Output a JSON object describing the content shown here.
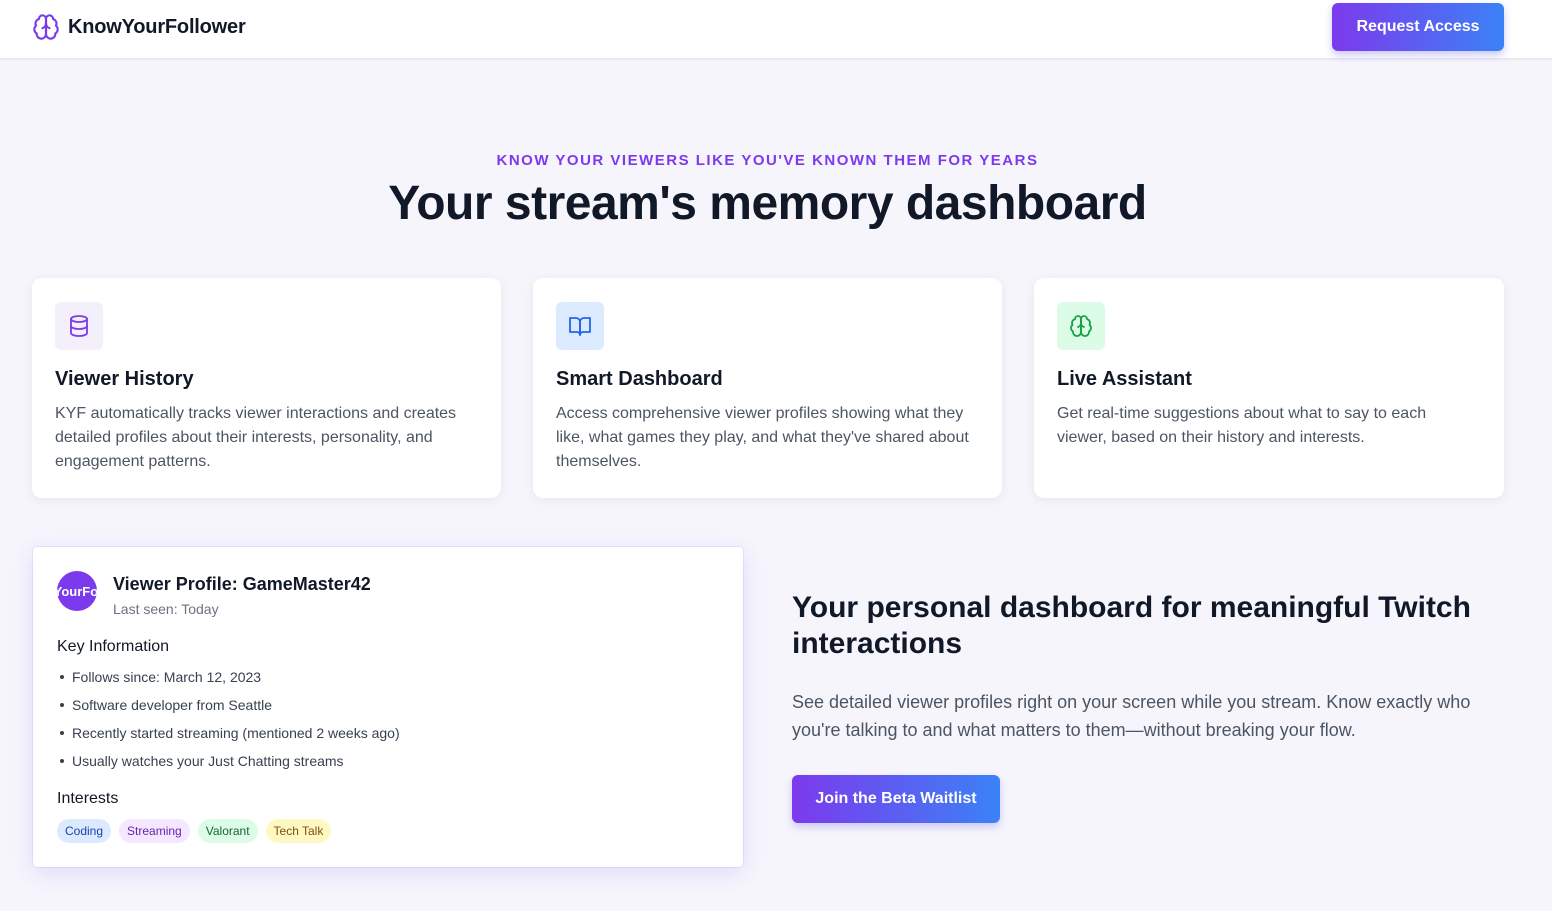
{
  "brand": {
    "name": "KnowYourFollower",
    "icon": "brain-icon",
    "accent": "#7c3aed"
  },
  "header": {
    "cta_label": "Request Access"
  },
  "hero": {
    "eyebrow": "KNOW YOUR VIEWERS LIKE YOU'VE KNOWN THEM FOR YEARS",
    "title": "Your stream's memory dashboard"
  },
  "features": [
    {
      "icon": "database-icon",
      "title": "Viewer History",
      "description": "KYF automatically tracks viewer interactions and creates detailed profiles about their interests, personality, and engagement patterns."
    },
    {
      "icon": "book-open-icon",
      "title": "Smart Dashboard",
      "description": "Access comprehensive viewer profiles showing what they like, what games they play, and what they've shared about themselves."
    },
    {
      "icon": "brain-icon",
      "title": "Live Assistant",
      "description": "Get real-time suggestions about what to say to each viewer, based on their history and interests."
    }
  ],
  "profile": {
    "avatar_text": "KnowYourFollower",
    "name": "Viewer Profile: GameMaster42",
    "last_seen": "Last seen: Today",
    "key_info_heading": "Key Information",
    "facts": [
      "Follows since: March 12, 2023",
      "Software developer from Seattle",
      "Recently started streaming (mentioned 2 weeks ago)",
      "Usually watches your Just Chatting streams"
    ],
    "interests_heading": "Interests",
    "interests": [
      "Coding",
      "Streaming",
      "Valorant",
      "Tech Talk"
    ]
  },
  "pitch": {
    "title": "Your personal dashboard for meaningful Twitch interactions",
    "description": "See detailed viewer profiles right on your screen while you stream. Know exactly who you're talking to and what matters to them—without breaking your flow.",
    "cta_label": "Join the Beta Waitlist"
  }
}
